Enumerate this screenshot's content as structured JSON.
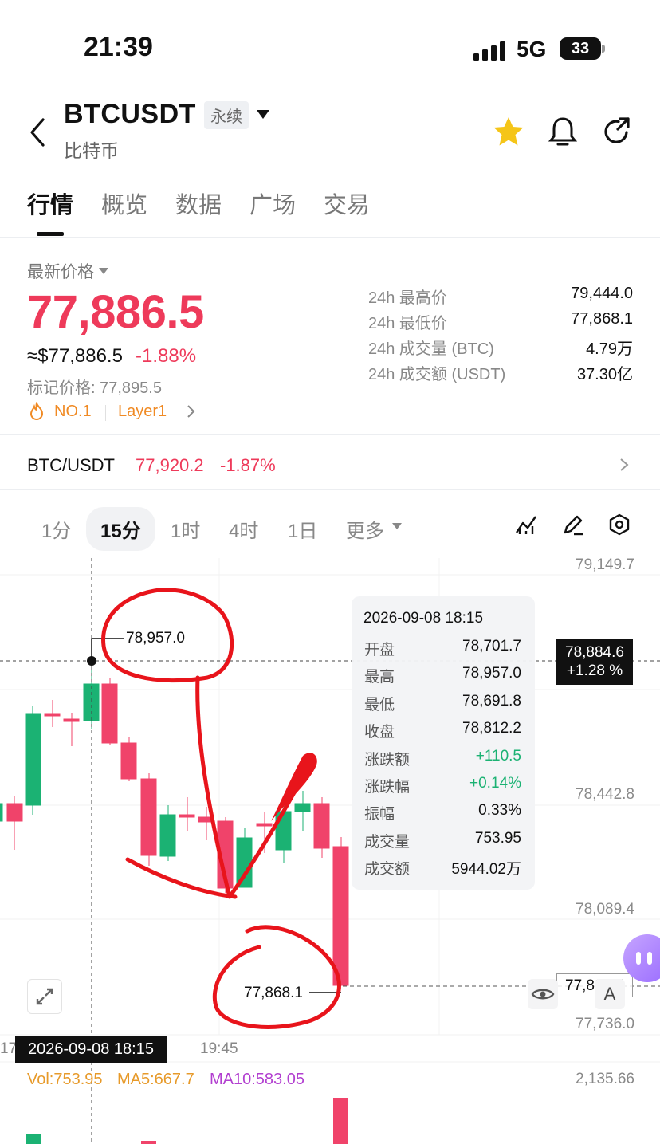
{
  "status_bar": {
    "time": "21:39",
    "network": "5G",
    "battery": "33"
  },
  "header": {
    "symbol": "BTCUSDT",
    "contract_tag": "永续",
    "coin_name": "比特币"
  },
  "tabs": [
    {
      "label": "行情",
      "active": true
    },
    {
      "label": "概览"
    },
    {
      "label": "数据"
    },
    {
      "label": "广场"
    },
    {
      "label": "交易"
    }
  ],
  "ticker": {
    "price_label": "最新价格",
    "last_price": "77,886.5",
    "usd_price": "≈$77,886.5",
    "change_pct": "-1.88%",
    "mark_price": "标记价格: 77,895.5",
    "rank_tag": "NO.1",
    "sector_tag": "Layer1"
  },
  "stats": [
    {
      "label": "24h 最高价",
      "value": "79,444.0"
    },
    {
      "label": "24h 最低价",
      "value": "77,868.1"
    },
    {
      "label": "24h 成交量 (BTC)",
      "value": "4.79万"
    },
    {
      "label": "24h 成交额 (USDT)",
      "value": "37.30亿"
    }
  ],
  "spot": {
    "pair": "BTC/USDT",
    "price": "77,920.2",
    "change": "-1.87%"
  },
  "intervals": [
    {
      "label": "1分"
    },
    {
      "label": "15分",
      "active": true
    },
    {
      "label": "1时"
    },
    {
      "label": "4时"
    },
    {
      "label": "1日"
    },
    {
      "label": "更多"
    }
  ],
  "chart": {
    "y_axis": [
      "79,149.7",
      "78,442.8",
      "78,089.4",
      "77,736.0"
    ],
    "high_marker": "78,957.0",
    "low_marker": "77,868.1",
    "crosshair_price": "78,884.6",
    "crosshair_change": "+1.28 %",
    "current_price_box": "77,886.5",
    "crosshair_time": "2026-09-08 18:15",
    "x_tick_left": "17",
    "x_tick": "19:45",
    "tooltip": {
      "date": "2026-09-08 18:15",
      "rows": [
        {
          "label": "开盘",
          "value": "78,701.7"
        },
        {
          "label": "最高",
          "value": "78,957.0"
        },
        {
          "label": "最低",
          "value": "78,691.8"
        },
        {
          "label": "收盘",
          "value": "78,812.2"
        },
        {
          "label": "涨跌额",
          "value": "+110.5",
          "color": "#1bb273"
        },
        {
          "label": "涨跌幅",
          "value": "+0.14%",
          "color": "#1bb273"
        },
        {
          "label": "振幅",
          "value": "0.33%"
        },
        {
          "label": "成交量",
          "value": "753.95"
        },
        {
          "label": "成交额",
          "value": "5944.02万"
        }
      ]
    },
    "volume": {
      "vol": "Vol:753.95",
      "ma5": "MA5:667.7",
      "ma10": "MA10:583.05",
      "axis_top": "2,135.66"
    },
    "colors": {
      "up": "#1bb273",
      "down": "#f0436a",
      "annotation": "#e8141b"
    }
  }
}
